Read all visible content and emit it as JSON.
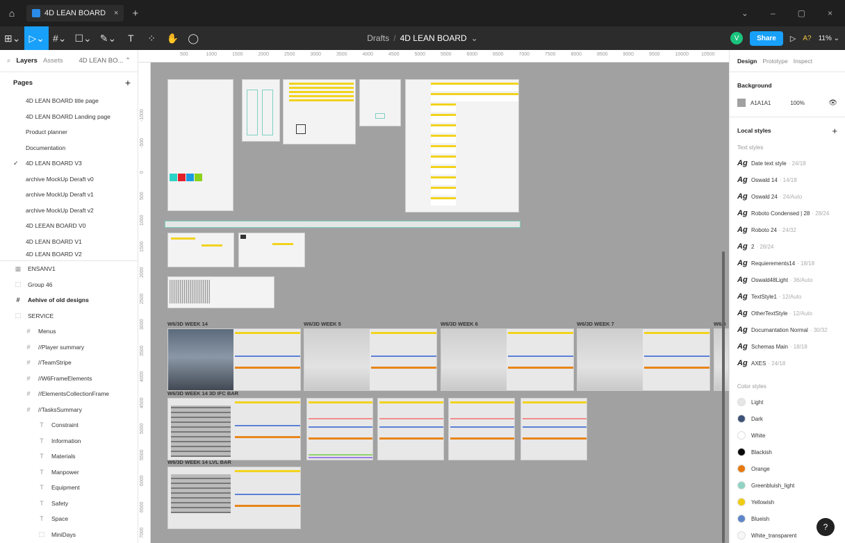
{
  "tabbar": {
    "home_icon": "home-icon",
    "file_tab": "4D LEAN BOARD",
    "close": "×",
    "plus": "+"
  },
  "window": {
    "chevron": "⌄",
    "minimize": "–",
    "restore": "▢",
    "close": "×"
  },
  "toolbar": {
    "main_menu": "⊞⌄",
    "move": "▷⌄",
    "frame": "#⌄",
    "shape": "☐⌄",
    "pen": "✎⌄",
    "text": "T",
    "resources": "⁘",
    "hand": "✋",
    "comment": "◯"
  },
  "breadcrumb": {
    "project": "Drafts",
    "separator": "/",
    "file": "4D LEAN BOARD",
    "chevron": "⌄"
  },
  "toolbar_right": {
    "avatar": "V",
    "share": "Share",
    "present": "▷",
    "help": "A?",
    "zoom": "11% ⌄"
  },
  "left": {
    "tabs": {
      "search": "⌕",
      "layers": "Layers",
      "assets": "Assets",
      "page": "4D LEAN BO... ⌃"
    },
    "pages_title": "Pages",
    "pages_add": "+",
    "pages": [
      "4D LEAN BOARD title page",
      "4D LEAN BOARD Landing page",
      "Product planner",
      "Documentation",
      "4D LEAN BOARD  V3",
      "archive MockUp Deraft v0",
      "archive MockUp Deraft v1",
      "archive MockUp Deraft v2",
      "4D LEEAN BOARD V0",
      "4D LEAN BOARD V1",
      "4D LEAN BOARD V2"
    ],
    "current_check": "✓",
    "layers": [
      {
        "icon": "▦",
        "label": "ENSANV1"
      },
      {
        "icon": "⬚",
        "label": "Group 46"
      },
      {
        "icon": "#",
        "label": "Aehive of old designs"
      },
      {
        "icon": "⬚",
        "label": "SERVICE"
      },
      {
        "icon": "#",
        "label": "Menus"
      },
      {
        "icon": "#",
        "label": "//Player summary"
      },
      {
        "icon": "#",
        "label": "//TeamStripe"
      },
      {
        "icon": "#",
        "label": "//W6FrameElements"
      },
      {
        "icon": "#",
        "label": "//ElementsCollectionFrame"
      },
      {
        "icon": "#",
        "label": "//TasksSummary"
      },
      {
        "icon": "T",
        "label": "Constraint"
      },
      {
        "icon": "T",
        "label": "Information"
      },
      {
        "icon": "T",
        "label": "Materials"
      },
      {
        "icon": "T",
        "label": "Manpower"
      },
      {
        "icon": "T",
        "label": "Equipment"
      },
      {
        "icon": "T",
        "label": "Safety"
      },
      {
        "icon": "T",
        "label": "Space"
      },
      {
        "icon": "⬚",
        "label": "MiniDays"
      }
    ]
  },
  "canvas": {
    "ruler_top": [
      "500",
      "1000",
      "1500",
      "2000",
      "2500",
      "3000",
      "3500",
      "4000",
      "4500",
      "5000",
      "5500",
      "6000",
      "6500",
      "7000",
      "7500",
      "8000",
      "8500",
      "9000",
      "9500",
      "10000",
      "10500"
    ],
    "ruler_left": [
      "-1000",
      "-500",
      "0",
      "500",
      "1000",
      "1500",
      "2000",
      "2500",
      "3000",
      "3500",
      "4000",
      "4500",
      "5000",
      "5500",
      "6000",
      "6500",
      "7000"
    ],
    "frame_labels": {
      "week14": "W6/3D WEEK 14",
      "week5": "W6/3D WEEK 5",
      "week6": "W6/3D WEEK 6",
      "week7": "W6/3D WEEK 7",
      "week_cut": "W6/3",
      "ifc": "W6/3D WEEK 14 3D IFC BAR",
      "lvl": "W6/3D WEEK 14 LVL BAR"
    },
    "background": "#A1A1A1"
  },
  "right": {
    "tabs": [
      "Design",
      "Prototype",
      "Inspect"
    ],
    "background_title": "Background",
    "bg_hex": "A1A1A1",
    "bg_opacity": "100%",
    "eye_icon": "eye-icon",
    "local_styles": "Local styles",
    "add": "+",
    "text_styles_title": "Text styles",
    "text_styles": [
      {
        "name": "Date text style",
        "meta": "· 24/18"
      },
      {
        "name": "Oswald 14",
        "meta": "· 14/18"
      },
      {
        "name": "Oswald 24",
        "meta": "· 24/Auto"
      },
      {
        "name": "Roboto Condensed | 28",
        "meta": "· 28/24"
      },
      {
        "name": "Roboto 24",
        "meta": "· 24/32"
      },
      {
        "name": "2",
        "meta": "· 28/24"
      },
      {
        "name": "Requierements14",
        "meta": "· 18/18"
      },
      {
        "name": "Oswald48Light",
        "meta": "· 36/Auto"
      },
      {
        "name": "TextStyle1",
        "meta": "· 12/Auto"
      },
      {
        "name": "OtherTextStyle",
        "meta": "· 12/Auto"
      },
      {
        "name": "Documantation Normal",
        "meta": "· 30/32"
      },
      {
        "name": "Schemas Main",
        "meta": "· 18/18"
      },
      {
        "name": "AXES",
        "meta": "· 24/18"
      }
    ],
    "ag": "Ag",
    "color_styles_title": "Color styles",
    "color_styles": [
      {
        "name": "Light",
        "color": "#e6e6e6"
      },
      {
        "name": "Dark",
        "color": "#3e5277"
      },
      {
        "name": "White",
        "color": "#ffffff"
      },
      {
        "name": "Blackish",
        "color": "#0a0a0a"
      },
      {
        "name": "Orange",
        "color": "#e8790f"
      },
      {
        "name": "Greenbluish_light",
        "color": "#8fd3c4"
      },
      {
        "name": "Yellowish",
        "color": "#f0cc12"
      },
      {
        "name": "Blueish",
        "color": "#5e86c8"
      },
      {
        "name": "White_transparent",
        "color": "#f7f7f7"
      }
    ],
    "help": "?"
  },
  "colors": {
    "accent": "#18a0fb",
    "yellow": "#f2d31b",
    "orange": "#e88519",
    "blue": "#5b7fd6",
    "canvas": "#a1a1a1"
  }
}
